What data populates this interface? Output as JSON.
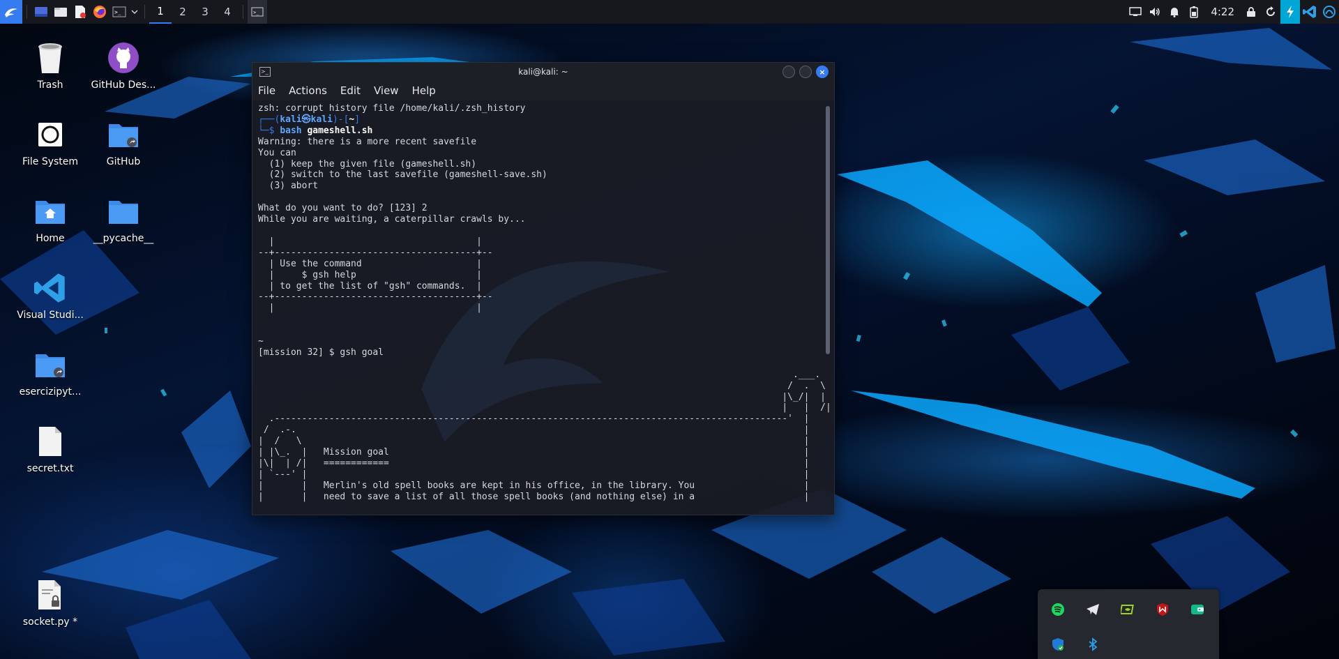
{
  "panel": {
    "workspaces": [
      "1",
      "2",
      "3",
      "4"
    ],
    "clock": "4:22"
  },
  "desktop": {
    "icons": [
      {
        "label": "Trash"
      },
      {
        "label": "GitHub Des..."
      },
      {
        "label": "File System"
      },
      {
        "label": "GitHub"
      },
      {
        "label": "Home"
      },
      {
        "label": "__pycache__"
      },
      {
        "label": "Visual Studi..."
      },
      {
        "label": "esercizipyt..."
      },
      {
        "label": "secret.txt"
      },
      {
        "label": "socket.py *"
      }
    ]
  },
  "terminal": {
    "title": "kali@kali: ~",
    "menu": [
      "File",
      "Actions",
      "Edit",
      "View",
      "Help"
    ],
    "lines": {
      "l1": "zsh: corrupt history file /home/kali/.zsh_history",
      "prompt_top": "┌──(",
      "prompt_user": "kali㉿kali",
      "prompt_mid": ")-[",
      "prompt_dir": "~",
      "prompt_end": "]",
      "prompt_bottom": "└─$ ",
      "cmd_name": "bash ",
      "cmd_arg": "gameshell.sh",
      "body": "Warning: there is a more recent savefile\nYou can\n  (1) keep the given file (gameshell.sh)\n  (2) switch to the last savefile (gameshell-save.sh)\n  (3) abort\n\nWhat do you want to do? [123] 2\nWhile you are waiting, a caterpillar crawls by...\n\n  |                                     |\n--+-------------------------------------+--\n  | Use the command                     |\n  |     $ gsh help                      |\n  | to get the list of \"gsh\" commands.  |\n--+-------------------------------------+--\n  |                                     |\n\n\n~\n[mission 32] $ gsh goal\n\n                                                                                                  .___.\n                                                                                                 /  .  \\\n                                                                                                |\\_/|  |\n                                                                                                |   |  /|\n  .----------------------------------------------------------------------------------------------'  |\n /  .-.                                                                                             |\n|  /   \\                                                                                            |\n| |\\_.  |   Mission goal                                                                            |\n|\\|  | /|   ============                                                                            |\n| `---' |                                                                                           |\n|       |   Merlin's old spell books are kept in his office, in the library. You                    |\n|       |   need to save a list of all those spell books (and nothing else) in a                    |"
    }
  },
  "colors": {
    "accent": "#367bf0",
    "panel_bg": "#16181d",
    "terminal_bg": "#1a1c24"
  }
}
